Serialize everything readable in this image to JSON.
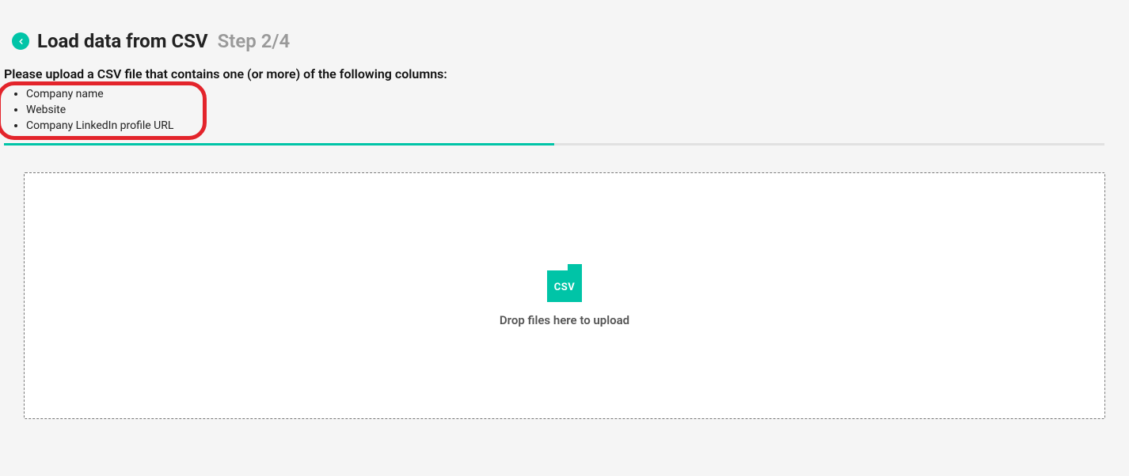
{
  "header": {
    "title": "Load data from CSV",
    "step": "Step 2/4"
  },
  "instructions": "Please upload a CSV file that contains one (or more) of the following columns:",
  "columns": [
    "Company name",
    "Website",
    "Company LinkedIn profile URL"
  ],
  "progress_percent": 50,
  "dropzone": {
    "icon_label": "CSV",
    "text": "Drop files here to upload"
  }
}
